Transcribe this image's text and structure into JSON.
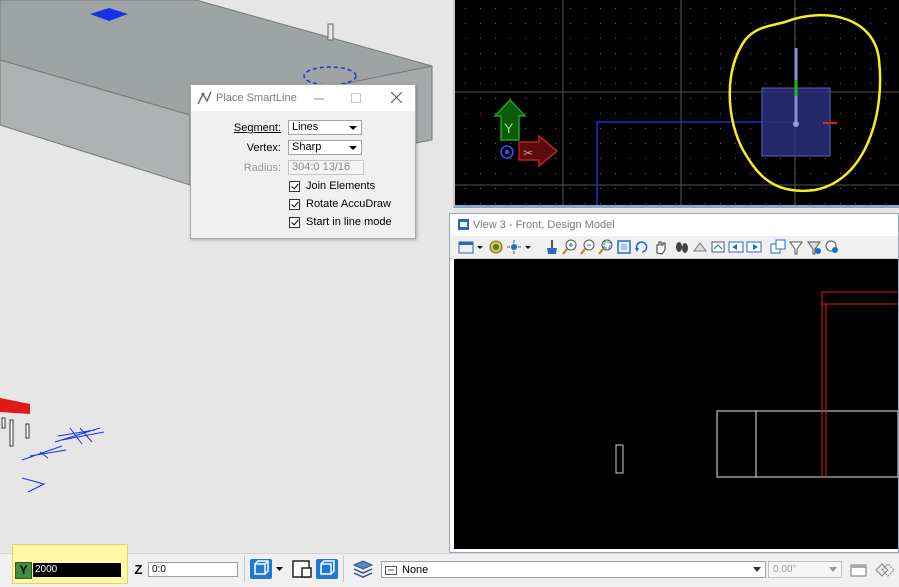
{
  "colors": {
    "highlight": "#fff9a8",
    "dialog_bg": "#f0f0f0",
    "view_bg": "#000000",
    "circle": "#ffff00",
    "accudraw_y": "#1a8a1a",
    "accudraw_x": "#b01c1c"
  },
  "dialog": {
    "title": "Place SmartLine",
    "segment_label": "Segment:",
    "segment_value": "Lines",
    "vertex_label": "Vertex:",
    "vertex_value": "Sharp",
    "radius_label": "Radius:",
    "radius_value": "304:0 13/16",
    "join_label": "Join Elements",
    "rotate_label": "Rotate AccuDraw",
    "start_label": "Start in line mode",
    "join_checked": true,
    "rotate_checked": true,
    "start_checked": true
  },
  "view3": {
    "title": "View 3 - Front, Design Model"
  },
  "accudraw": {
    "y_glyph": "Y",
    "x_glyph": "✂"
  },
  "statusbar": {
    "y_axis": "Y",
    "y_value": "2000",
    "z_axis": "Z",
    "z_value": "0:0",
    "level_value": "None",
    "angle_value": "0.00°"
  }
}
